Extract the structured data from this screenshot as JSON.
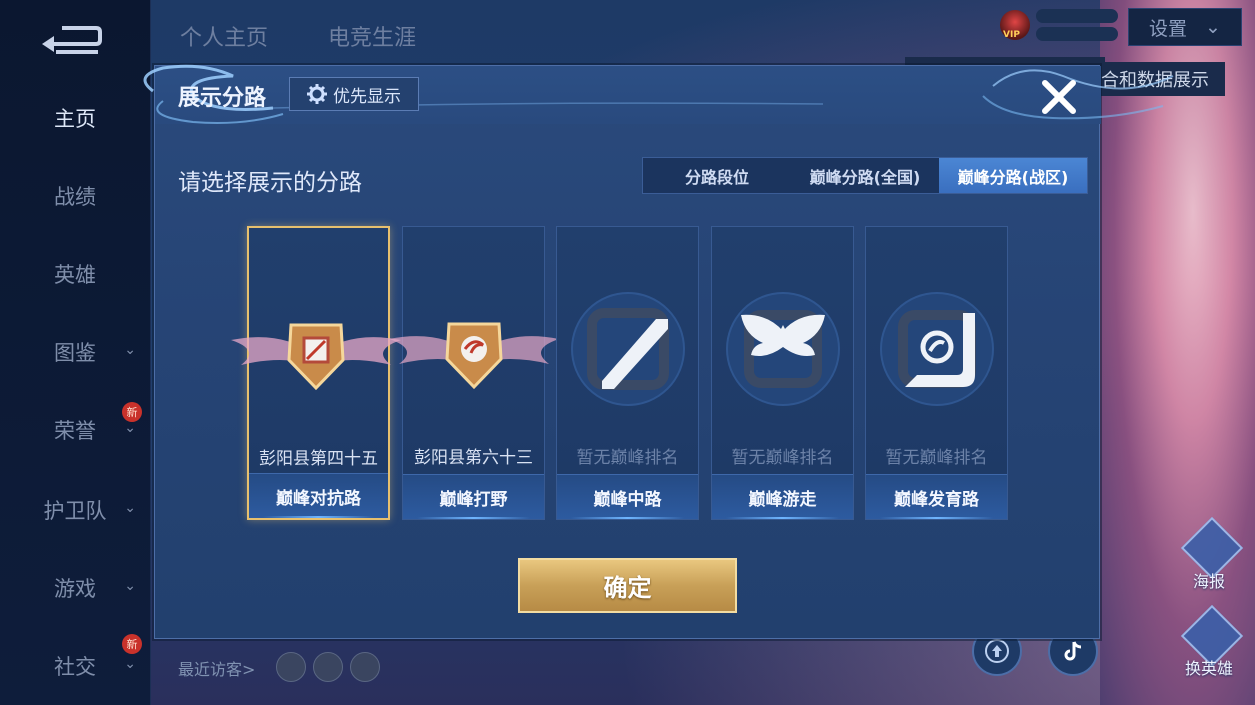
{
  "sidebar": {
    "items": [
      {
        "label": "主页",
        "active": true
      },
      {
        "label": "战绩"
      },
      {
        "label": "英雄"
      },
      {
        "label": "图鉴",
        "chevron": true
      },
      {
        "label": "荣誉",
        "chevron": true,
        "badge": "新"
      },
      {
        "label": "护卫队",
        "chevron": true
      },
      {
        "label": "游戏",
        "chevron": true
      },
      {
        "label": "社交",
        "chevron": true,
        "badge": "新"
      }
    ]
  },
  "top_tabs": [
    "个人主页",
    "电竞生涯"
  ],
  "top_right": {
    "settings_label": "设置",
    "vip_label": "VIP"
  },
  "background": {
    "partial_text": "合和数据展示",
    "recent_visitors_label": "最近访客>",
    "right_icons": [
      "海报",
      "换英雄"
    ]
  },
  "dialog": {
    "title": "展示分路",
    "priority_button": "优先显示",
    "subtitle": "请选择展示的分路",
    "segments": [
      {
        "label": "分路段位",
        "active": false
      },
      {
        "label": "巅峰分路(全国)",
        "active": false
      },
      {
        "label": "巅峰分路(战区)",
        "active": true
      }
    ],
    "cards": [
      {
        "role": "巅峰对抗路",
        "rank": "彭阳县第四十五",
        "ranked": true,
        "selected": true,
        "icon": "clash-lane-icon"
      },
      {
        "role": "巅峰打野",
        "rank": "彭阳县第六十三",
        "ranked": true,
        "selected": false,
        "icon": "jungle-icon"
      },
      {
        "role": "巅峰中路",
        "rank": "暂无巅峰排名",
        "ranked": false,
        "selected": false,
        "icon": "mid-lane-icon"
      },
      {
        "role": "巅峰游走",
        "rank": "暂无巅峰排名",
        "ranked": false,
        "selected": false,
        "icon": "roam-icon"
      },
      {
        "role": "巅峰发育路",
        "rank": "暂无巅峰排名",
        "ranked": false,
        "selected": false,
        "icon": "farm-lane-icon"
      }
    ],
    "confirm_label": "确定"
  },
  "colors": {
    "accent_gold": "#e7c06e",
    "segment_active": "#4b86d4",
    "dialog_bg": "#264475"
  }
}
